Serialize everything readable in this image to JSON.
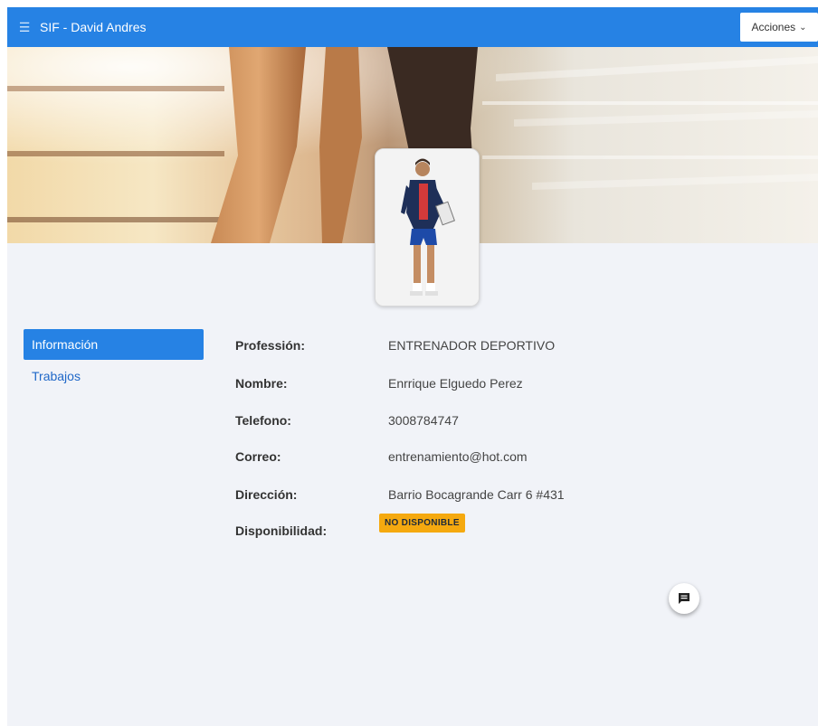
{
  "header": {
    "menu_icon": "hamburger-icon",
    "title": "SIF - David Andres",
    "actions_label": "Acciones",
    "actions_icon": "chevron-down-icon",
    "brand_color": "#2682e4"
  },
  "sidebar": {
    "items": [
      {
        "label": "Información",
        "active": true
      },
      {
        "label": "Trabajos",
        "active": false
      }
    ]
  },
  "profile": {
    "fields": [
      {
        "label": "Professión:",
        "value": "ENTRENADOR DEPORTIVO"
      },
      {
        "label": "Nombre:",
        "value": "Enrrique Elguedo Perez"
      },
      {
        "label": "Telefono:",
        "value": "3008784747"
      },
      {
        "label": "Correo:",
        "value": "entrenamiento@hot.com"
      },
      {
        "label": "Dirección:",
        "value": "Barrio Bocagrande Carr 6 #431"
      }
    ],
    "availability_label": "Disponibilidad:",
    "availability_status": "NO DISPONIBLE",
    "availability_color": "#f5a90f"
  },
  "chat": {
    "icon": "chat-icon"
  }
}
